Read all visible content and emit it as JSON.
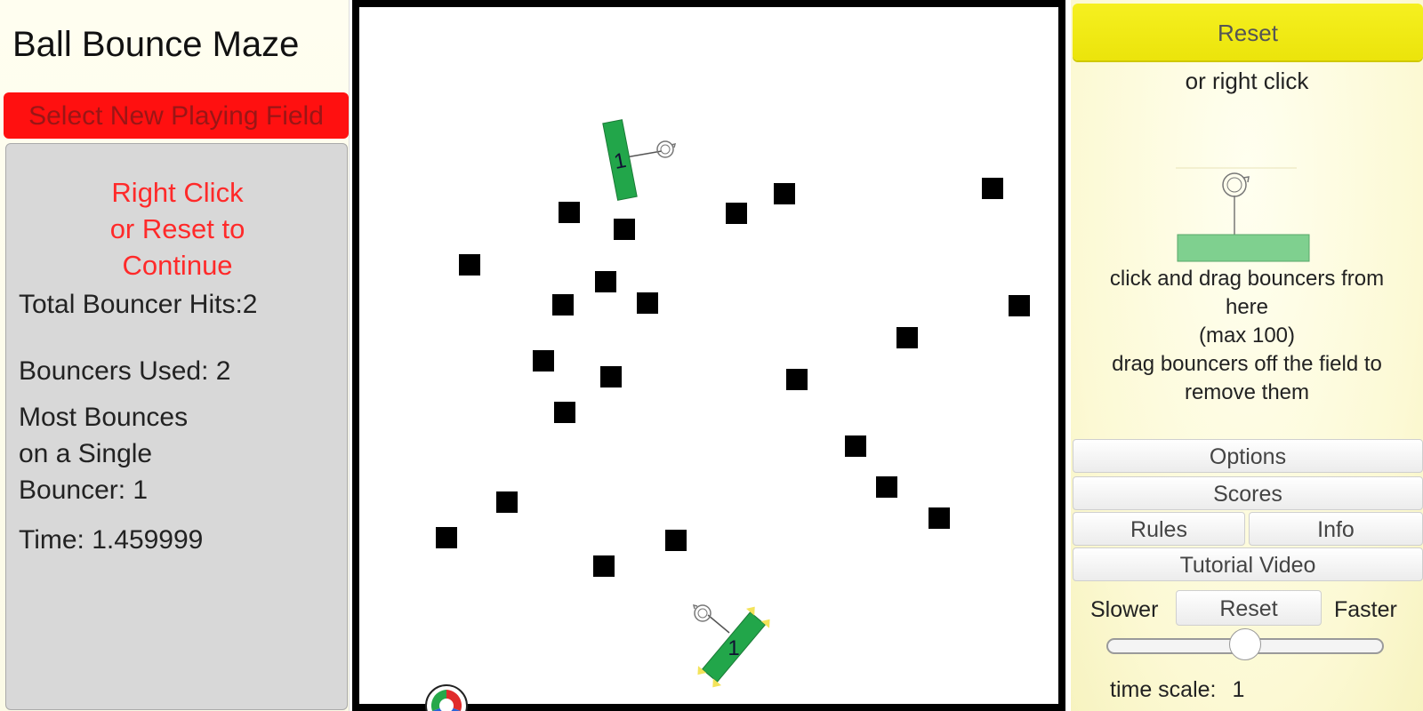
{
  "title": "Ball Bounce Maze",
  "select_field_label": "Select New Playing Field",
  "stats": {
    "continue_message": "Right Click\nor Reset to\nContinue",
    "total_hits_label": "Total Bouncer Hits:",
    "total_hits_value": "2",
    "bouncers_used_label": "Bouncers Used: ",
    "bouncers_used_value": "2",
    "most_bounces_label": "Most Bounces\non a Single\nBouncer: ",
    "most_bounces_value": "1",
    "time_label": "Time: ",
    "time_value": "1.459999"
  },
  "field": {
    "bouncers": [
      {
        "label": "1"
      },
      {
        "label": "1"
      }
    ]
  },
  "right_panel": {
    "reset_label": "Reset",
    "right_click_text": "or right click",
    "instructions": "click and drag bouncers from\nhere\n(max 100)\ndrag bouncers off the field to\nremove them",
    "options_label": "Options",
    "scores_label": "Scores",
    "rules_label": "Rules",
    "info_label": "Info",
    "tutorial_label": "Tutorial Video",
    "slower_label": "Slower",
    "speed_reset_label": "Reset",
    "faster_label": "Faster",
    "time_scale_label": "time scale:",
    "time_scale_value": "1",
    "time_scale_position": 0.5
  },
  "colors": {
    "bouncer_green": "#22a64a",
    "reset_yellow": "#f2ec14",
    "select_red": "#ff1010",
    "message_red": "#ff2a2a"
  },
  "icons": [
    "rotate-handle-icon",
    "app-logo-icon"
  ]
}
